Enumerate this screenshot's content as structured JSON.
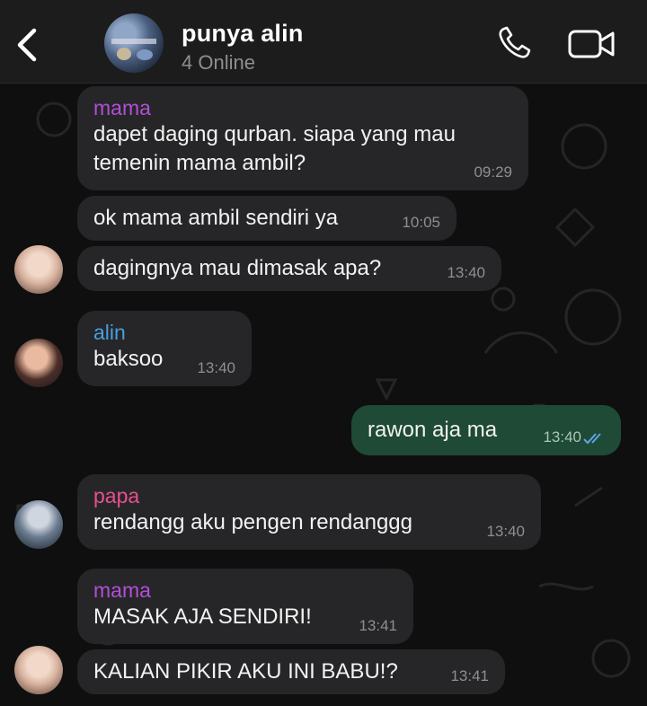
{
  "header": {
    "back_icon": "chevron-left-icon",
    "title": "punya alin",
    "subtitle": "4 Online",
    "call_icon": "phone-icon",
    "video_icon": "video-camera-icon"
  },
  "colors": {
    "mama": "#b34fd6",
    "alin": "#4a9ee0",
    "papa": "#e8508f",
    "outgoing_bubble": "#1f4a35",
    "incoming_bubble": "#262628",
    "read_ticks": "#5aa7e6"
  },
  "messages": [
    {
      "sender": "mama",
      "lines": [
        "dapet daging qurban. siapa yang mau",
        "temenin mama ambil?"
      ],
      "time": "09:29"
    },
    {
      "lines": [
        "ok mama ambil sendiri ya"
      ],
      "time": "10:05"
    },
    {
      "lines": [
        "dagingnya mau dimasak apa?"
      ],
      "time": "13:40"
    },
    {
      "sender": "alin",
      "lines": [
        "baksoo"
      ],
      "time": "13:40"
    },
    {
      "lines": [
        "rawon aja ma"
      ],
      "time": "13:40",
      "status": "read"
    },
    {
      "sender": "papa",
      "lines": [
        "rendangg aku pengen rendanggg"
      ],
      "time": "13:40"
    },
    {
      "sender": "mama",
      "lines": [
        "MASAK AJA SENDIRI!"
      ],
      "time": "13:41"
    },
    {
      "lines": [
        "KALIAN PIKIR AKU INI BABU!?"
      ],
      "time": "13:41"
    }
  ]
}
